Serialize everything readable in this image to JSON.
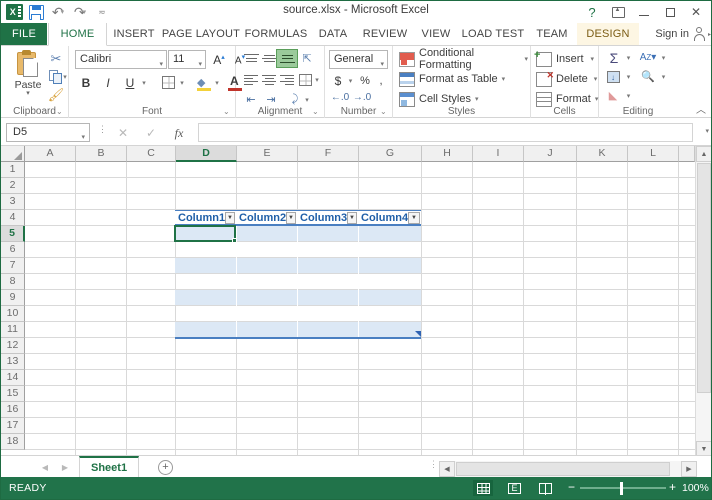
{
  "window": {
    "title": "source.xlsx - Microsoft Excel",
    "app_logo": "excel-logo",
    "quick_access": [
      {
        "name": "save",
        "icon": "save-icon"
      },
      {
        "name": "undo",
        "icon": "undo-icon"
      },
      {
        "name": "redo",
        "icon": "redo-icon"
      },
      {
        "name": "customize",
        "icon": "customize-qat-icon"
      }
    ],
    "controls": {
      "help": "?",
      "ribbon_display": "ribbon-display-options-icon",
      "minimize": "minimize-icon",
      "maximize": "maximize-icon",
      "close": "✕"
    }
  },
  "tabs": {
    "items": [
      {
        "label": "FILE",
        "state": "file"
      },
      {
        "label": "HOME",
        "state": "active"
      },
      {
        "label": "INSERT",
        "state": "normal"
      },
      {
        "label": "PAGE LAYOUT",
        "state": "normal"
      },
      {
        "label": "FORMULAS",
        "state": "normal"
      },
      {
        "label": "DATA",
        "state": "normal"
      },
      {
        "label": "REVIEW",
        "state": "normal"
      },
      {
        "label": "VIEW",
        "state": "normal"
      },
      {
        "label": "LOAD TEST",
        "state": "normal"
      },
      {
        "label": "TEAM",
        "state": "normal"
      },
      {
        "label": "DESIGN",
        "state": "contextual"
      }
    ],
    "sign_in": "Sign in"
  },
  "ribbon": {
    "groups": [
      {
        "name": "Clipboard"
      },
      {
        "name": "Font"
      },
      {
        "name": "Alignment"
      },
      {
        "name": "Number"
      },
      {
        "name": "Styles"
      },
      {
        "name": "Cells"
      },
      {
        "name": "Editing"
      }
    ],
    "clipboard": {
      "paste_label": "Paste",
      "cut": "cut-icon",
      "copy": "copy-icon",
      "format_painter": "format-painter-icon"
    },
    "font": {
      "family": "Calibri",
      "size": "11",
      "grow_font": "A",
      "shrink_font": "A",
      "bold": "B",
      "italic": "I",
      "underline": "U",
      "borders": "borders-icon",
      "fill_color": "fill-color-icon",
      "font_color": "font-color-icon"
    },
    "number": {
      "format": "General",
      "accounting": "$",
      "percent": "%",
      "comma": ",",
      "increase_decimal": "increase-decimal-icon",
      "decrease_decimal": "decrease-decimal-icon"
    },
    "styles": {
      "conditional_formatting": "Conditional Formatting",
      "format_as_table": "Format as Table",
      "cell_styles": "Cell Styles"
    },
    "cells": {
      "insert": "Insert",
      "delete": "Delete",
      "format": "Format"
    },
    "editing": {
      "autosum": "Σ",
      "fill": "fill-icon",
      "clear": "clear-icon",
      "sort_filter": "sort-filter-icon",
      "find_select": "find-select-icon"
    }
  },
  "formula_bar": {
    "name_box": "D5",
    "cancel": "✕",
    "enter": "✓",
    "insert_function": "fx",
    "value": "",
    "expand": "expand-formula-bar-icon"
  },
  "grid": {
    "columns": [
      "A",
      "B",
      "C",
      "D",
      "E",
      "F",
      "G",
      "H",
      "I",
      "J",
      "K",
      "L"
    ],
    "selected_column": "D",
    "rows": [
      1,
      2,
      3,
      4,
      5,
      6,
      7,
      8,
      9,
      10,
      11,
      12,
      13,
      14,
      15,
      16,
      17,
      18
    ],
    "selected_row": 5,
    "selected_cell": "D5",
    "table": {
      "header_row": 4,
      "first_data_row": 5,
      "last_data_row": 11,
      "headers": [
        "Column1",
        "Column2",
        "Column3",
        "Column4"
      ],
      "columns": [
        "D",
        "E",
        "F",
        "G"
      ],
      "filter_glyph": "▼",
      "banded_rows": [
        5,
        7,
        9,
        11
      ],
      "data": [
        [
          "",
          "",
          "",
          ""
        ],
        [
          "",
          "",
          "",
          ""
        ],
        [
          "",
          "",
          "",
          ""
        ],
        [
          "",
          "",
          "",
          ""
        ],
        [
          "",
          "",
          "",
          ""
        ],
        [
          "",
          "",
          "",
          ""
        ],
        [
          "",
          "",
          "",
          ""
        ]
      ]
    }
  },
  "sheet_bar": {
    "prev": "◀",
    "next": "▶",
    "sheets": [
      {
        "label": "Sheet1",
        "active": true
      }
    ],
    "new_sheet": "+"
  },
  "status_bar": {
    "mode": "READY",
    "views": [
      {
        "name": "normal-view",
        "active": true
      },
      {
        "name": "page-layout-view",
        "active": false
      },
      {
        "name": "page-break-preview",
        "active": false
      }
    ],
    "zoom_out": "−",
    "zoom_in": "+",
    "zoom_level": "100%"
  },
  "colors": {
    "brand_green": "#21734a",
    "table_header_blue": "#1f5fa8",
    "table_band": "#dce8f5",
    "table_border": "#4a7fc1",
    "contextual_tab": "#fdf6e3"
  }
}
